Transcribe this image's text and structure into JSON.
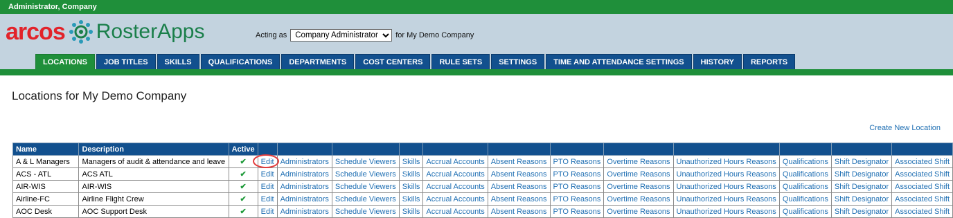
{
  "topbar": {
    "user": "Administrator, Company"
  },
  "logo": {
    "arcos": "arcos",
    "roster": "RosterApps"
  },
  "acting": {
    "prefix": "Acting as",
    "selected": "Company Administrator",
    "suffix": "for My Demo Company"
  },
  "tabs": [
    "LOCATIONS",
    "JOB TITLES",
    "SKILLS",
    "QUALIFICATIONS",
    "DEPARTMENTS",
    "COST CENTERS",
    "RULE SETS",
    "SETTINGS",
    "TIME AND ATTENDANCE SETTINGS",
    "HISTORY",
    "REPORTS"
  ],
  "page": {
    "title": "Locations for My Demo Company",
    "create_link": "Create New Location"
  },
  "table": {
    "headers": {
      "name": "Name",
      "description": "Description",
      "active": "Active"
    },
    "links": [
      "Edit",
      "Administrators",
      "Schedule Viewers",
      "Skills",
      "Accrual Accounts",
      "Absent Reasons",
      "PTO Reasons",
      "Overtime Reasons",
      "Unauthorized Hours Reasons",
      "Qualifications",
      "Shift Designator",
      "Associated Shift"
    ],
    "rows": [
      {
        "name": "A & L Managers",
        "description": "Managers of audit & attendance and leave",
        "active": "✔"
      },
      {
        "name": "ACS - ATL",
        "description": "ACS ATL",
        "active": "✔"
      },
      {
        "name": "AIR-WIS",
        "description": "AIR-WIS",
        "active": "✔"
      },
      {
        "name": "Airline-FC",
        "description": "Airline Flight Crew",
        "active": "✔"
      },
      {
        "name": "AOC Desk",
        "description": "AOC Support Desk",
        "active": "✔"
      }
    ]
  },
  "colors": {
    "green": "#1f8f3a",
    "navy": "#12508e",
    "link": "#1f6fb3",
    "header_bg": "#c3d3df",
    "highlight": "#e23b3b"
  }
}
